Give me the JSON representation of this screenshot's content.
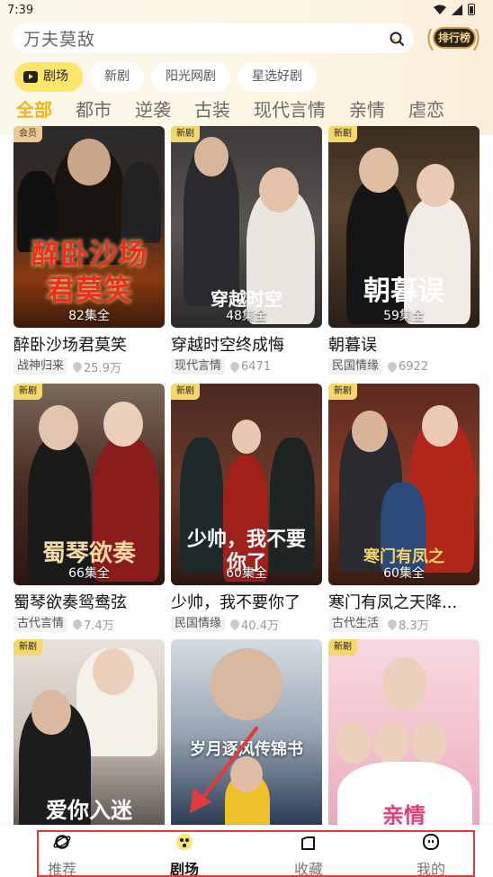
{
  "status": {
    "time": "7:39"
  },
  "search": {
    "placeholder": "万夫莫敌",
    "rank_label": "排行榜"
  },
  "chips": [
    {
      "label": "剧场",
      "active": true
    },
    {
      "label": "新剧",
      "active": false
    },
    {
      "label": "阳光网剧",
      "active": false
    },
    {
      "label": "星选好剧",
      "active": false
    }
  ],
  "categories": [
    "全部",
    "都市",
    "逆袭",
    "古装",
    "现代言情",
    "亲情",
    "虐恋"
  ],
  "dramas": [
    {
      "tag": "会员",
      "poster_text": "醉卧沙场\n君莫笑",
      "count": "82集全",
      "title": "醉卧沙场君莫笑",
      "genre": "战神归来",
      "views": "25.9万"
    },
    {
      "tag": "新剧",
      "poster_text": "穿越时空",
      "count": "48集全",
      "title": "穿越时空终成悔",
      "genre": "现代言情",
      "views": "6471"
    },
    {
      "tag": "新剧",
      "poster_text": "朝暮误",
      "count": "59集全",
      "title": "朝暮误",
      "genre": "民国情缘",
      "views": "6922"
    },
    {
      "tag": "新剧",
      "poster_text": "蜀琴欲奏",
      "count": "66集全",
      "title": "蜀琴欲奏鸳鸯弦",
      "genre": "古代言情",
      "views": "7.4万"
    },
    {
      "tag": "新剧",
      "poster_text": "少帅，我不要你了",
      "count": "60集全",
      "title": "少帅，我不要你了",
      "genre": "民国情缘",
      "views": "40.4万"
    },
    {
      "tag": "新剧",
      "poster_text": "寒门有凤之",
      "count": "60集全",
      "title": "寒门有凤之天降...",
      "genre": "古代生活",
      "views": "8.3万"
    },
    {
      "tag": "新剧",
      "poster_text": "爱你入迷",
      "count": "",
      "title": "",
      "genre": "",
      "views": ""
    },
    {
      "tag": "",
      "poster_text": "岁月逐风传锦书",
      "count": "",
      "title": "",
      "genre": "",
      "views": ""
    },
    {
      "tag": "新剧",
      "poster_text": "亲情",
      "count": "",
      "title": "",
      "genre": "",
      "views": ""
    }
  ],
  "bottom_nav": [
    {
      "label": "推荐",
      "icon": "planet-icon",
      "active": false
    },
    {
      "label": "剧场",
      "icon": "theater-icon",
      "active": true
    },
    {
      "label": "收藏",
      "icon": "folder-icon",
      "active": false
    },
    {
      "label": "我的",
      "icon": "profile-icon",
      "active": false
    }
  ],
  "colors": {
    "accent": "#f0b420",
    "chip_active": "#fce66b",
    "highlight_box": "#e23b3b"
  }
}
